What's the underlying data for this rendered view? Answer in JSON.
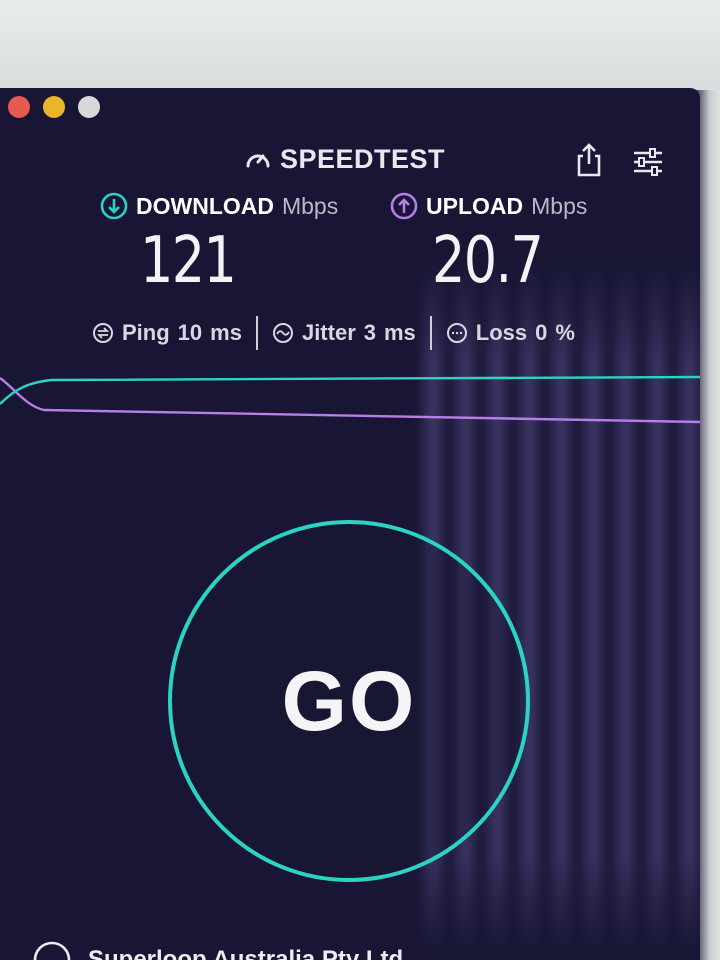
{
  "app": {
    "title": "SPEEDTEST"
  },
  "toolbar": {
    "share_icon": "share-icon",
    "settings_icon": "settings-sliders-icon"
  },
  "download": {
    "label": "DOWNLOAD",
    "unit": "Mbps",
    "value": "121",
    "icon": "arrow-down-circle-icon"
  },
  "upload": {
    "label": "UPLOAD",
    "unit": "Mbps",
    "value": "20.7",
    "icon": "arrow-up-circle-icon"
  },
  "stats": {
    "ping": {
      "label": "Ping",
      "value": "10",
      "unit": "ms"
    },
    "jitter": {
      "label": "Jitter",
      "value": "3",
      "unit": "ms"
    },
    "loss": {
      "label": "Loss",
      "value": "0",
      "unit": "%"
    }
  },
  "go": {
    "label": "GO"
  },
  "provider": {
    "name": "Superloop Australia Pty Ltd"
  },
  "colors": {
    "background": "#181634",
    "download_accent": "#2bd3c3",
    "upload_accent": "#b77ee8",
    "text": "#f3f3f7"
  }
}
